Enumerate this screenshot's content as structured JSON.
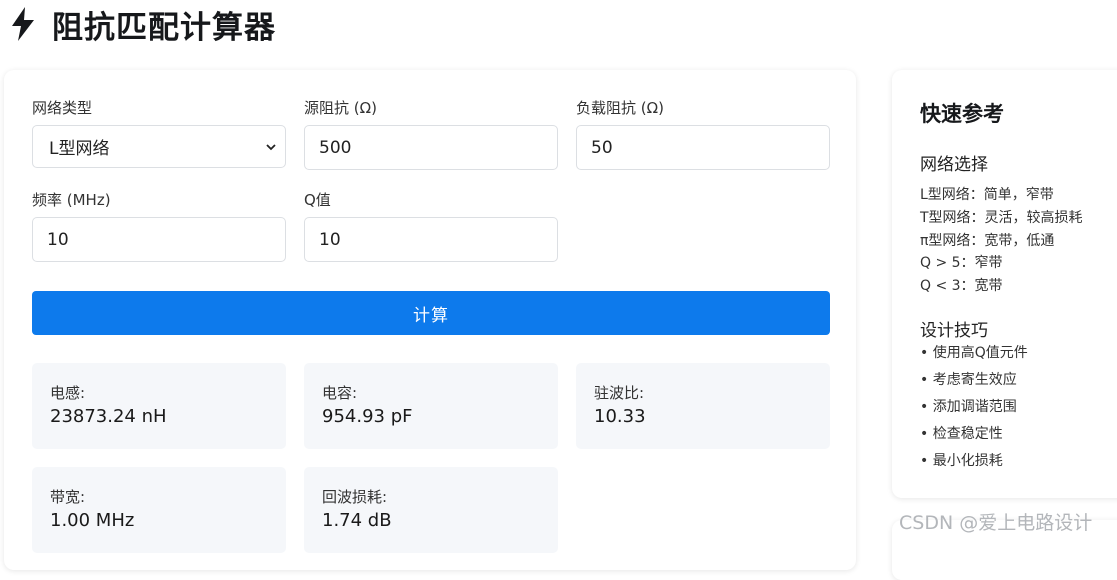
{
  "header": {
    "title": "阻抗匹配计算器",
    "icon": "lightning-bolt-icon"
  },
  "form": {
    "network_type": {
      "label": "网络类型",
      "value": "L型网络"
    },
    "source_impedance": {
      "label": "源阻抗 (Ω)",
      "value": "500"
    },
    "load_impedance": {
      "label": "负载阻抗 (Ω)",
      "value": "50"
    },
    "frequency": {
      "label": "频率 (MHz)",
      "value": "10"
    },
    "q_value": {
      "label": "Q值",
      "value": "10"
    },
    "calculate_label": "计算"
  },
  "results": {
    "inductance": {
      "label": "电感:",
      "value": "23873.24 nH"
    },
    "capacitance": {
      "label": "电容:",
      "value": "954.93 pF"
    },
    "vswr": {
      "label": "驻波比:",
      "value": "10.33"
    },
    "bandwidth": {
      "label": "带宽:",
      "value": "1.00 MHz"
    },
    "return_loss": {
      "label": "回波损耗:",
      "value": "1.74 dB"
    }
  },
  "reference": {
    "title": "快速参考",
    "network_section": {
      "heading": "网络选择",
      "lines": [
        "L型网络：简单，窄带",
        "T型网络：灵活，较高损耗",
        "π型网络：宽带，低通",
        "Q > 5：窄带",
        "Q < 3：宽带"
      ]
    },
    "tips_section": {
      "heading": "设计技巧",
      "items": [
        "• 使用高Q值元件",
        "• 考虑寄生效应",
        "• 添加调谐范围",
        "• 检查稳定性",
        "• 最小化损耗"
      ]
    }
  },
  "watermark": "CSDN @爱上电路设计",
  "colors": {
    "primary_button": "#0d7aec",
    "result_bg": "#f5f7fa",
    "border": "#dcdfe3"
  }
}
